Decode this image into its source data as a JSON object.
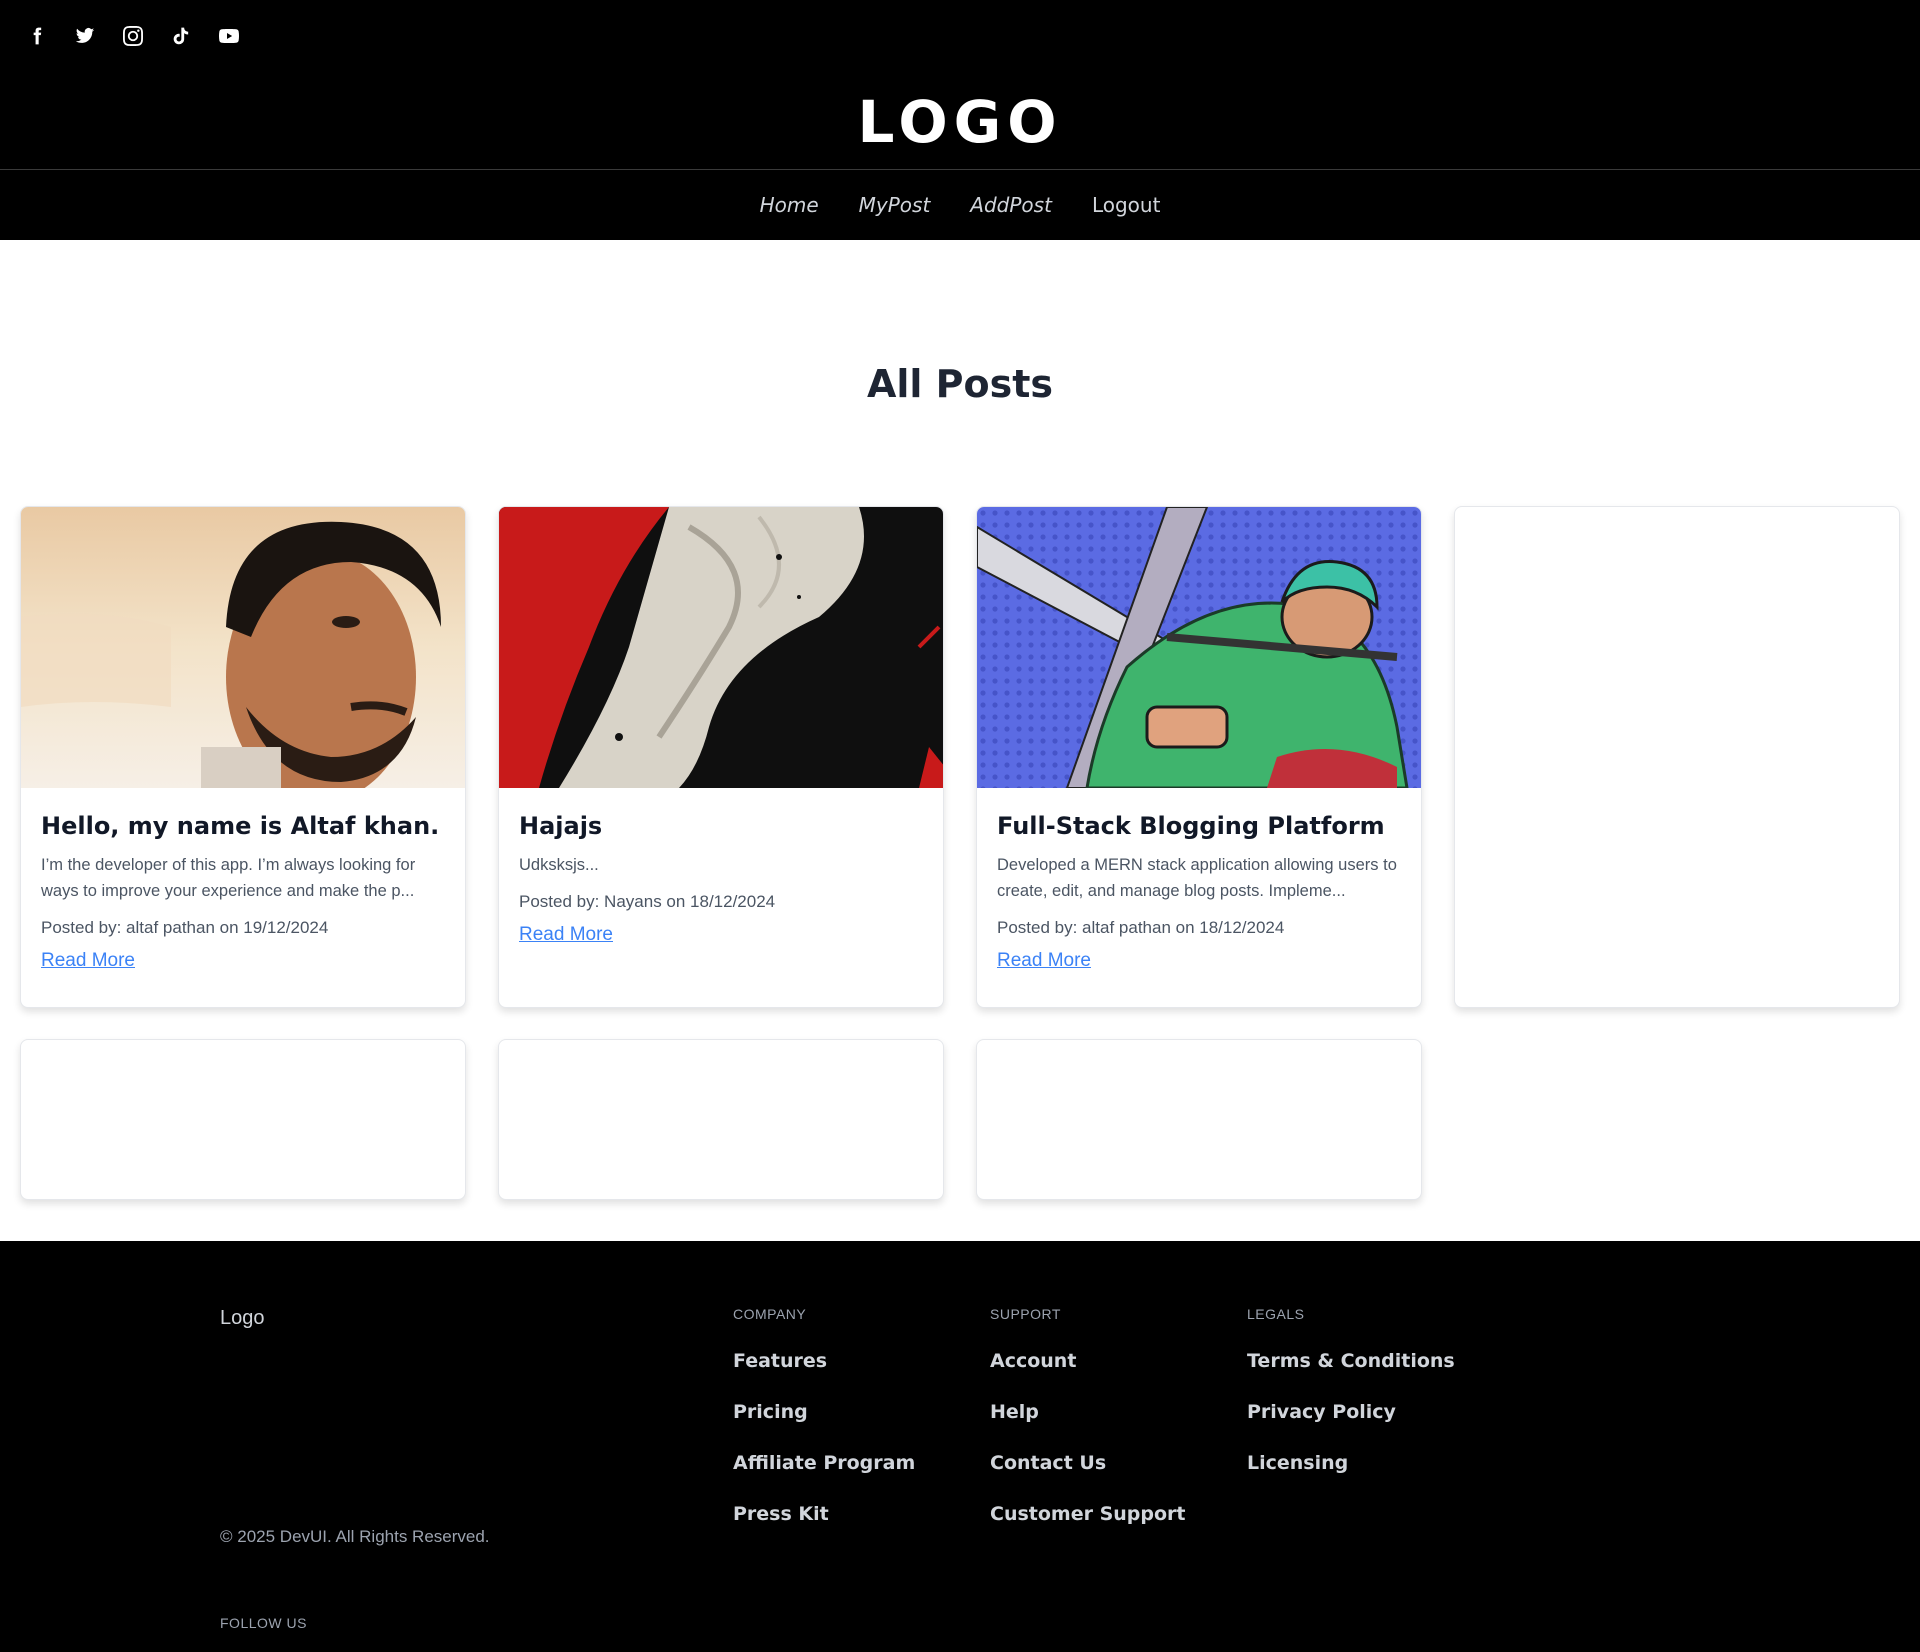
{
  "header": {
    "logo": "LOGO",
    "social_icons": [
      "facebook-icon",
      "twitter-icon",
      "instagram-icon",
      "tiktok-icon",
      "youtube-icon"
    ],
    "nav": [
      {
        "label": "Home"
      },
      {
        "label": "MyPost"
      },
      {
        "label": "AddPost"
      },
      {
        "label": "Logout"
      }
    ]
  },
  "main": {
    "title": "All Posts",
    "posts": [
      {
        "title": "Hello, my name is Altaf khan.",
        "excerpt": "I’m the developer of this app. I’m always looking for ways to improve your experience and make the p...",
        "meta": "Posted by: altaf pathan on 19/12/2024",
        "link": "Read More"
      },
      {
        "title": "Hajajs",
        "excerpt": "Udksksjs...",
        "meta": "Posted by: Nayans on 18/12/2024",
        "link": "Read More"
      },
      {
        "title": "Full-Stack Blogging Platform",
        "excerpt": "Developed a MERN stack application allowing users to create, edit, and manage blog posts. Impleme...",
        "meta": "Posted by: altaf pathan on 18/12/2024",
        "link": "Read More"
      }
    ]
  },
  "footer": {
    "logo": "Logo",
    "copyright": "© 2025 DevUI. All Rights Reserved.",
    "follow": "FOLLOW US",
    "columns": [
      {
        "heading": "COMPANY",
        "links": [
          "Features",
          "Pricing",
          "Affiliate Program",
          "Press Kit"
        ]
      },
      {
        "heading": "SUPPORT",
        "links": [
          "Account",
          "Help",
          "Contact Us",
          "Customer Support"
        ]
      },
      {
        "heading": "LEGALS",
        "links": [
          "Terms & Conditions",
          "Privacy Policy",
          "Licensing"
        ]
      }
    ]
  },
  "colors": {
    "header_bg": "#000000",
    "link_blue": "#3b82f6",
    "title_dark": "#1e2533"
  }
}
